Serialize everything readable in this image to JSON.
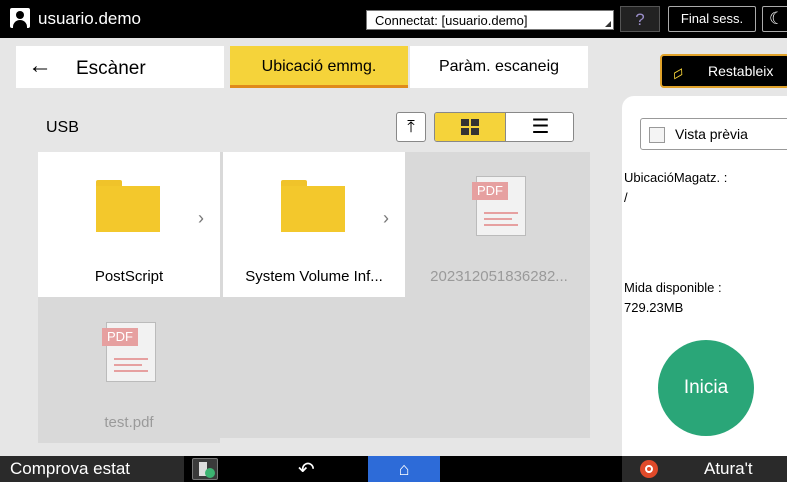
{
  "topbar": {
    "user_name": "usuario.demo",
    "connection": "Connectat: [usuario.demo]",
    "help_label": "?",
    "logout_label": "Final sess."
  },
  "header": {
    "title": "Escàner",
    "tabs": [
      {
        "label": "Ubicació emmg.",
        "active": true
      },
      {
        "label": "Paràm. escaneig",
        "active": false
      }
    ],
    "reset_label": "Restableix"
  },
  "browser": {
    "location": "USB",
    "view_mode": "grid",
    "items": [
      {
        "name": "PostScript",
        "type": "folder"
      },
      {
        "name": "System Volume Inf...",
        "type": "folder"
      },
      {
        "name": "202312051836282...",
        "type": "pdf",
        "tag": "PDF"
      },
      {
        "name": "test.pdf",
        "type": "pdf",
        "tag": "PDF"
      }
    ]
  },
  "side": {
    "preview_label": "Vista prèvia",
    "storage_label": "UbicacióMagatz. :",
    "storage_value": "/",
    "available_label": "Mida disponible :",
    "available_value": "729.23MB",
    "start_label": "Inicia"
  },
  "bottombar": {
    "status_label": "Comprova estat",
    "stop_label": "Atura't"
  },
  "colors": {
    "accent_yellow": "#f5d33a",
    "start_green": "#2aa678",
    "home_blue": "#2d6bd8",
    "stop_red": "#e04a2a"
  }
}
